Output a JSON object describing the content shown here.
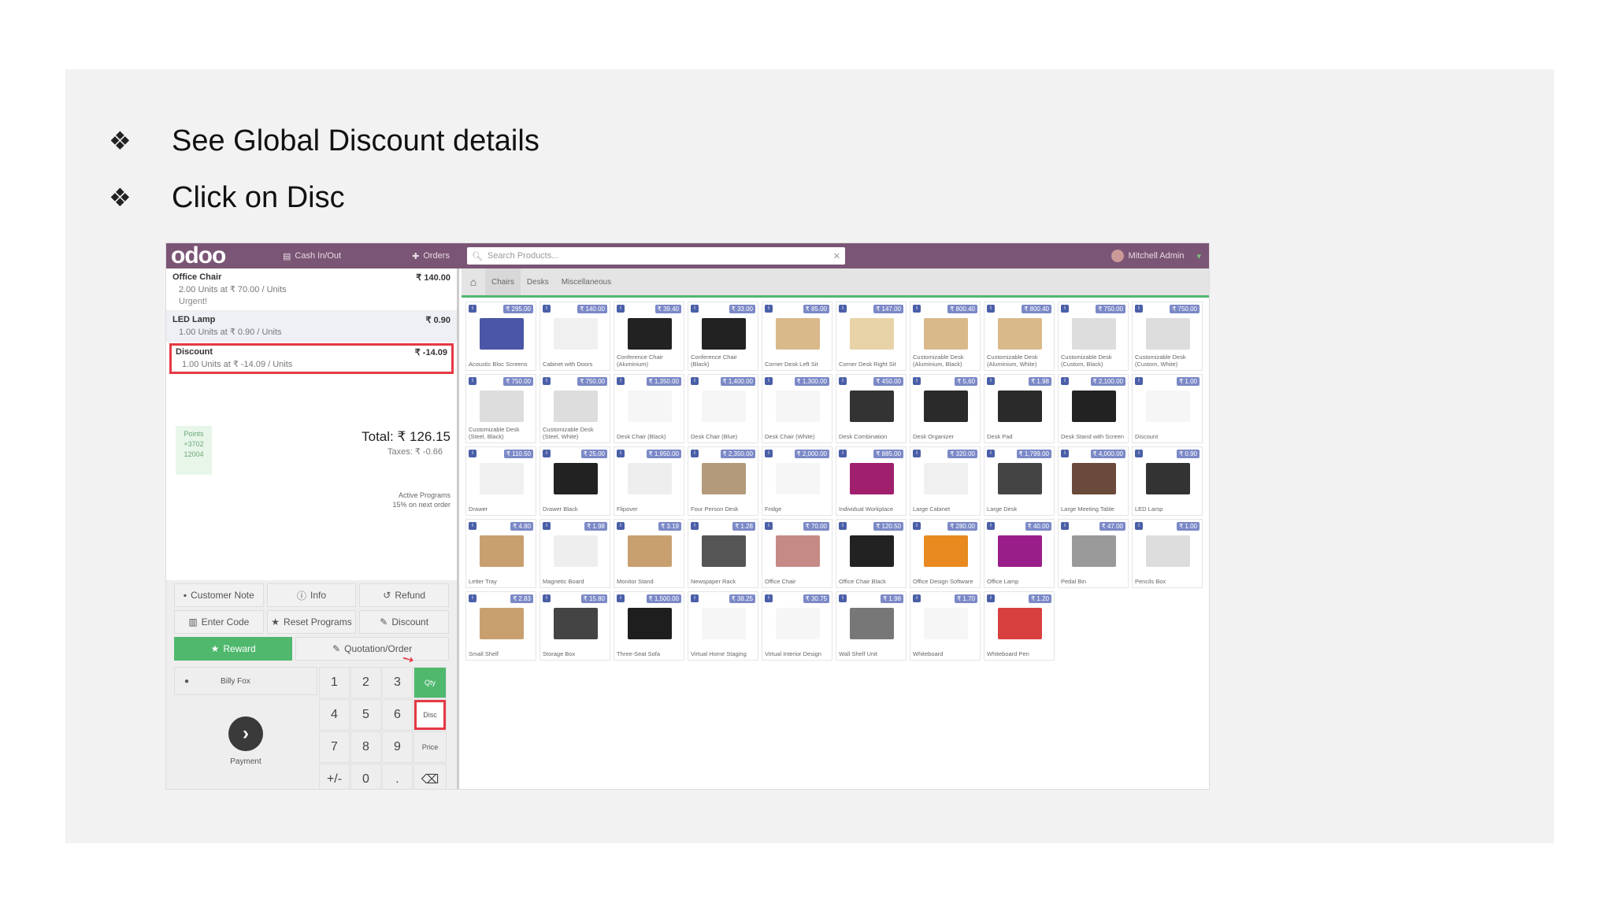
{
  "slide": {
    "bullets": [
      {
        "mark": "❖",
        "text": "See Global Discount details"
      },
      {
        "mark": "❖",
        "text": "Click on Disc"
      }
    ]
  },
  "pos": {
    "logo": "odoo",
    "cash_label": "Cash In/Out",
    "orders_label": "Orders",
    "search_placeholder": "Search Products...",
    "user_label": "Mitchell Admin",
    "categories": [
      "Chairs",
      "Desks",
      "Miscellaneous"
    ],
    "order_lines": [
      {
        "name": "Office Chair",
        "price": "₹ 140.00",
        "detail": "2.00 Units at ₹ 70.00 / Units",
        "note": "Urgent!"
      },
      {
        "name": "LED Lamp",
        "price": "₹ 0.90",
        "detail": "1.00 Units at ₹ 0.90 / Units",
        "note": ""
      },
      {
        "name": "Discount",
        "price": "₹ -14.09",
        "detail": "1.00 Units at ₹ -14.09 / Units",
        "note": ""
      }
    ],
    "points": [
      "Points",
      "+3702",
      "12004"
    ],
    "total": "Total: ₹ 126.15",
    "taxes": "Taxes: ₹ -0.66",
    "active_programs": [
      "Active Programs",
      "15% on next order"
    ],
    "control_rows": [
      [
        "Customer Note",
        "Info",
        "Refund"
      ],
      [
        "Enter Code",
        "Reset Programs",
        "Discount"
      ]
    ],
    "reward_label": "Reward",
    "quotation_label": "Quotation/Order",
    "customer_label": "Billy Fox",
    "payment_label": "Payment",
    "keys": [
      "1",
      "2",
      "3",
      "Qty",
      "4",
      "5",
      "6",
      "Disc",
      "7",
      "8",
      "9",
      "Price",
      "+/-",
      "0",
      ".",
      "⌫"
    ],
    "products": [
      {
        "name": "Acoustic Bloc Screens",
        "price": "₹ 295.00",
        "color": "#4a56a6"
      },
      {
        "name": "Cabinet with Doors",
        "price": "₹ 140.00",
        "color": "#f0f0f0"
      },
      {
        "name": "Conference Chair (Aluminium)",
        "price": "₹ 39.40",
        "color": "#222222"
      },
      {
        "name": "Conference Chair (Black)",
        "price": "₹ 33.00",
        "color": "#222222"
      },
      {
        "name": "Corner Desk Left Sit",
        "price": "₹ 85.00",
        "color": "#d9b98a"
      },
      {
        "name": "Corner Desk Right Sit",
        "price": "₹ 147.00",
        "color": "#e8d2a8"
      },
      {
        "name": "Customizable Desk (Aluminium, Black)",
        "price": "₹ 800.40",
        "color": "#d9b98a"
      },
      {
        "name": "Customizable Desk (Aluminium, White)",
        "price": "₹ 800.40",
        "color": "#d9b98a"
      },
      {
        "name": "Customizable Desk (Custom, Black)",
        "price": "₹ 750.00",
        "color": "#dddddd"
      },
      {
        "name": "Customizable Desk (Custom, White)",
        "price": "₹ 750.00",
        "color": "#dddddd"
      },
      {
        "name": "Customizable Desk (Steel, Black)",
        "price": "₹ 750.00",
        "color": "#dddddd"
      },
      {
        "name": "Customizable Desk (Steel, White)",
        "price": "₹ 750.00",
        "color": "#dddddd"
      },
      {
        "name": "Desk Chair (Black)",
        "price": "₹ 1,350.00",
        "color": "#f6f6f6"
      },
      {
        "name": "Desk Chair (Blue)",
        "price": "₹ 1,400.00",
        "color": "#f6f6f6"
      },
      {
        "name": "Desk Chair (White)",
        "price": "₹ 1,300.00",
        "color": "#f6f6f6"
      },
      {
        "name": "Desk Combination",
        "price": "₹ 450.00",
        "color": "#333333"
      },
      {
        "name": "Desk Organizer",
        "price": "₹ 5,60",
        "color": "#2a2a2a"
      },
      {
        "name": "Desk Pad",
        "price": "₹ 1.98",
        "color": "#2a2a2a"
      },
      {
        "name": "Desk Stand with Screen",
        "price": "₹ 2,100.00",
        "color": "#222222"
      },
      {
        "name": "Discount",
        "price": "₹ 1.00",
        "color": "#f6f6f6"
      },
      {
        "name": "Drawer",
        "price": "₹ 110.50",
        "color": "#f0f0f0"
      },
      {
        "name": "Drawer Black",
        "price": "₹ 25.00",
        "color": "#222222"
      },
      {
        "name": "Flipover",
        "price": "₹ 1,950.00",
        "color": "#eeeeee"
      },
      {
        "name": "Four Person Desk",
        "price": "₹ 2,350.00",
        "color": "#b29a7a"
      },
      {
        "name": "Fridge",
        "price": "₹ 2,000.00",
        "color": "#f6f6f6"
      },
      {
        "name": "Individual Workplace",
        "price": "₹ 885.00",
        "color": "#a0206e"
      },
      {
        "name": "Large Cabinet",
        "price": "₹ 320.00",
        "color": "#f0f0f0"
      },
      {
        "name": "Large Desk",
        "price": "₹ 1,799.00",
        "color": "#444444"
      },
      {
        "name": "Large Meeting Table",
        "price": "₹ 4,000.00",
        "color": "#6a4a3a"
      },
      {
        "name": "LED Lamp",
        "price": "₹ 0.90",
        "color": "#333333"
      },
      {
        "name": "Letter Tray",
        "price": "₹ 4.80",
        "color": "#c8a070"
      },
      {
        "name": "Magnetic Board",
        "price": "₹ 1.98",
        "color": "#eeeeee"
      },
      {
        "name": "Monitor Stand",
        "price": "₹ 3.19",
        "color": "#c8a070"
      },
      {
        "name": "Newspaper Rack",
        "price": "₹ 1.28",
        "color": "#555555"
      },
      {
        "name": "Office Chair",
        "price": "₹ 70.00",
        "color": "#c58a85"
      },
      {
        "name": "Office Chair Black",
        "price": "₹ 120.50",
        "color": "#222222"
      },
      {
        "name": "Office Design Software",
        "price": "₹ 280.00",
        "color": "#e88a20"
      },
      {
        "name": "Office Lamp",
        "price": "₹ 40.00",
        "color": "#9a1e8a"
      },
      {
        "name": "Pedal Bin",
        "price": "₹ 47.00",
        "color": "#9a9a9a"
      },
      {
        "name": "Pencils Box",
        "price": "₹ 1.00",
        "color": "#dddddd"
      },
      {
        "name": "Small Shelf",
        "price": "₹ 2.83",
        "color": "#c8a070"
      },
      {
        "name": "Storage Box",
        "price": "₹ 15.80",
        "color": "#444444"
      },
      {
        "name": "Three-Seat Sofa",
        "price": "₹ 1,500.00",
        "color": "#1e1e1e"
      },
      {
        "name": "Virtual Home Staging",
        "price": "₹ 38.25",
        "color": "#f6f6f6"
      },
      {
        "name": "Virtual Interior Design",
        "price": "₹ 30.75",
        "color": "#f6f6f6"
      },
      {
        "name": "Wall Shelf Unit",
        "price": "₹ 1.98",
        "color": "#777777"
      },
      {
        "name": "Whiteboard",
        "price": "₹ 1.70",
        "color": "#f6f6f6"
      },
      {
        "name": "Whiteboard Pen",
        "price": "₹ 1.20",
        "color": "#d84040"
      }
    ]
  }
}
